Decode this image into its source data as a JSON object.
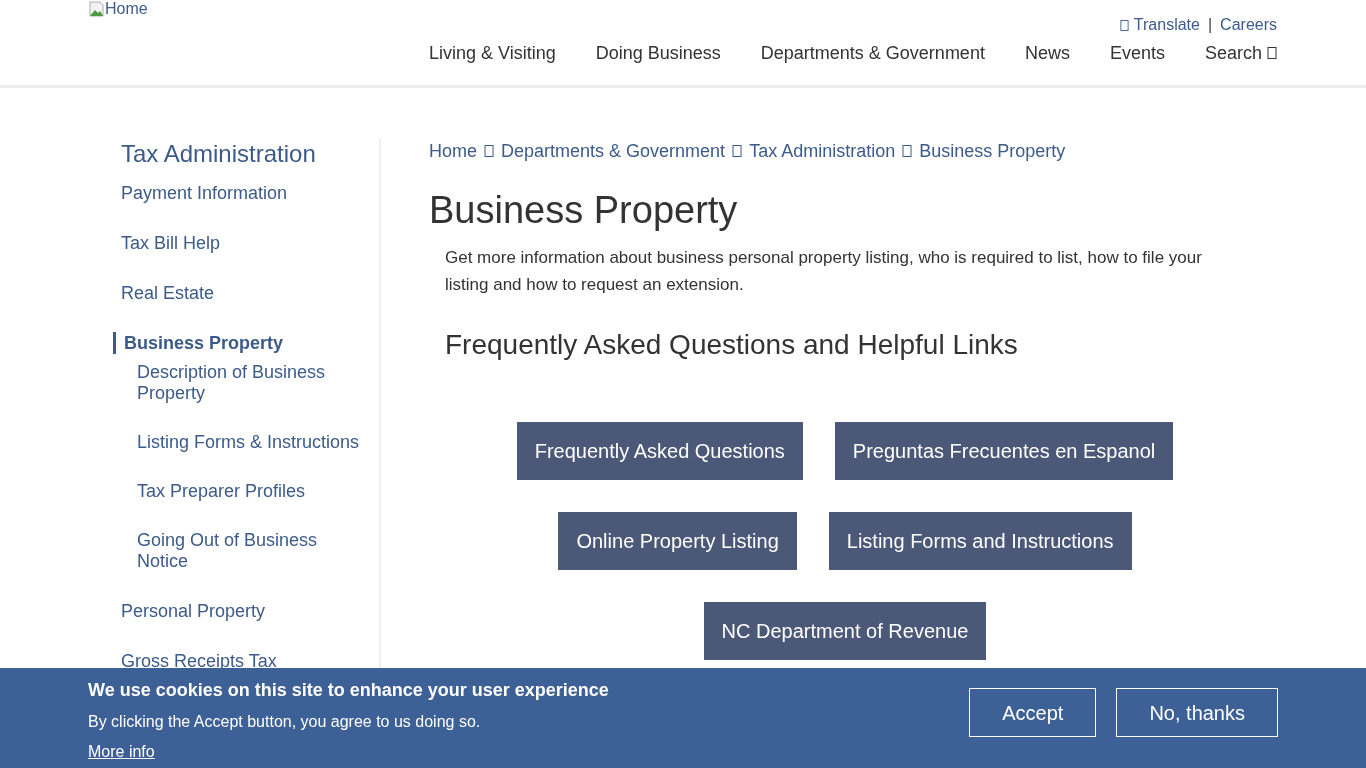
{
  "header": {
    "logo_alt": "Home",
    "utility_links": [
      {
        "label": "Translate",
        "icon": true
      },
      {
        "label": "Careers",
        "icon": false
      }
    ],
    "utility_separator": "|",
    "nav": [
      {
        "label": "Living & Visiting",
        "icon": false
      },
      {
        "label": "Doing Business",
        "icon": false
      },
      {
        "label": "Departments & Government",
        "icon": false
      },
      {
        "label": "News",
        "icon": false
      },
      {
        "label": "Events",
        "icon": false
      },
      {
        "label": "Search",
        "icon": true
      }
    ]
  },
  "sidebar": {
    "title": "Tax Administration",
    "items": [
      {
        "label": "Payment Information",
        "selected": false
      },
      {
        "label": "Tax Bill Help",
        "selected": false
      },
      {
        "label": "Real Estate",
        "selected": false
      },
      {
        "label": "Business Property",
        "selected": true,
        "children": [
          {
            "label": "Description of Business Property",
            "selected": false
          },
          {
            "label": "Listing Forms & Instructions",
            "selected": false
          },
          {
            "label": "Tax Preparer Profiles",
            "selected": false
          },
          {
            "label": "Going Out of Business Notice",
            "selected": false
          }
        ]
      },
      {
        "label": "Personal Property",
        "selected": false
      },
      {
        "label": "Gross Receipts Tax",
        "selected": false
      }
    ]
  },
  "breadcrumb": [
    "Home",
    "Departments & Government",
    "Tax Administration",
    "Business Property"
  ],
  "page_title": "Business Property",
  "intro": "Get more information about business personal property listing, who is required to list, how to file your listing and how to request an extension.",
  "section_heading": "Frequently Asked Questions and Helpful Links",
  "link_buttons": [
    [
      "Frequently Asked Questions",
      "Preguntas Frecuentes en Espanol"
    ],
    [
      "Online Property Listing",
      "Listing Forms and Instructions"
    ],
    [
      "NC Department of Revenue"
    ]
  ],
  "cookie_banner": {
    "title": "We use cookies on this site to enhance your user experience",
    "text": "By clicking the Accept button, you agree to us doing so.",
    "more_link": "More info",
    "buttons": [
      "Accept",
      "No, thanks"
    ]
  }
}
